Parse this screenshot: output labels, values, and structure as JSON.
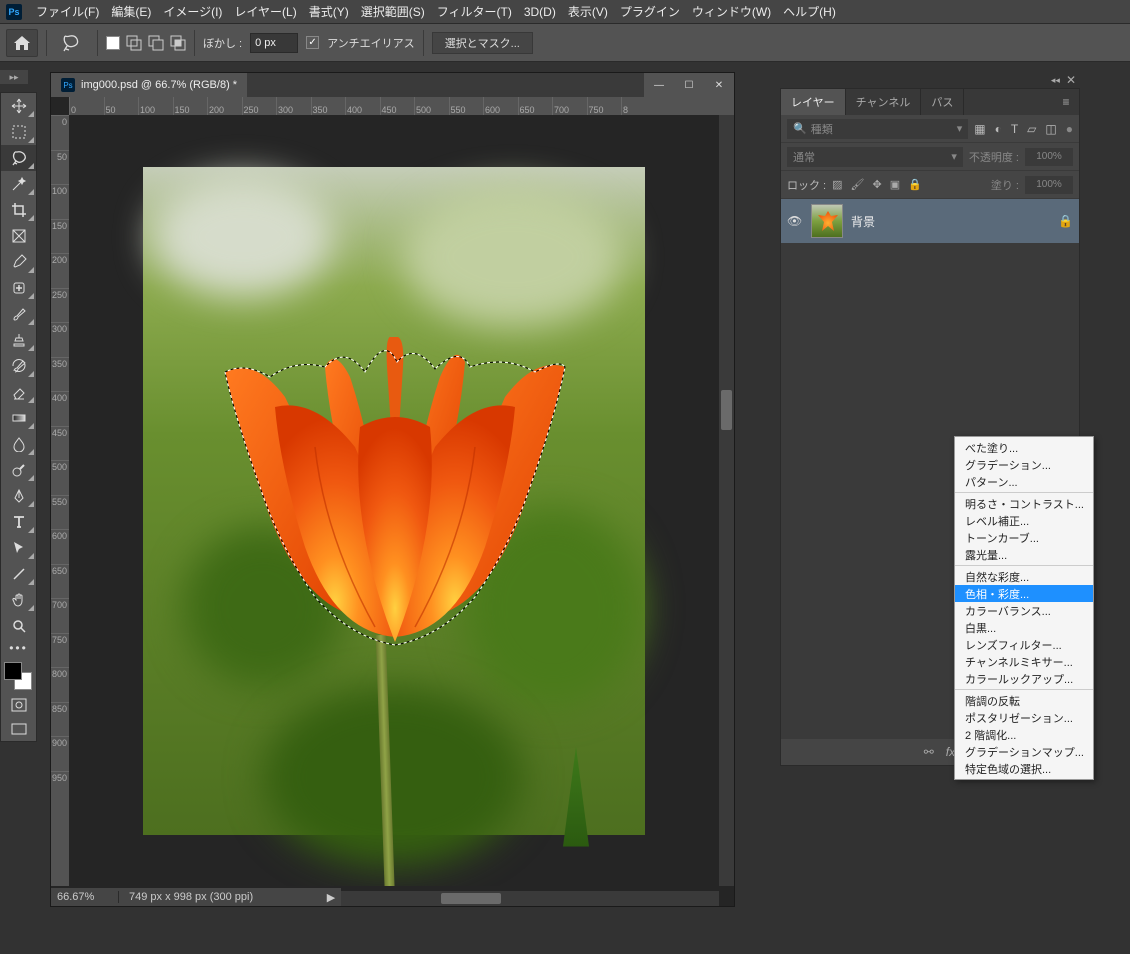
{
  "app_logo": "Ps",
  "menubar": [
    "ファイル(F)",
    "編集(E)",
    "イメージ(I)",
    "レイヤー(L)",
    "書式(Y)",
    "選択範囲(S)",
    "フィルター(T)",
    "3D(D)",
    "表示(V)",
    "プラグイン",
    "ウィンドウ(W)",
    "ヘルプ(H)"
  ],
  "options": {
    "blur_label": "ぼかし :",
    "blur_value": "0 px",
    "antialias": "アンチエイリアス",
    "antialias_checked": true,
    "select_mask": "選択とマスク..."
  },
  "document": {
    "tab_title": "img000.psd @ 66.7% (RGB/8) *",
    "zoom": "66.67%",
    "info": "749 px x 998 px (300 ppi)",
    "ruler_h": [
      "0",
      "50",
      "100",
      "150",
      "200",
      "250",
      "300",
      "350",
      "400",
      "450",
      "500",
      "550",
      "600",
      "650",
      "700",
      "750",
      "8"
    ],
    "ruler_v": [
      "0",
      "50",
      "100",
      "150",
      "200",
      "250",
      "300",
      "350",
      "400",
      "450",
      "500",
      "550",
      "600",
      "650",
      "700",
      "750",
      "800",
      "850",
      "900",
      "950"
    ]
  },
  "right_panel": {
    "tabs": [
      "レイヤー",
      "チャンネル",
      "パス"
    ],
    "kind_search": "種類",
    "blend_mode": "通常",
    "opacity_label": "不透明度 :",
    "opacity_value": "100%",
    "lock_label": "ロック :",
    "fill_label": "塗り :",
    "fill_value": "100%",
    "layer": {
      "name": "背景"
    }
  },
  "context_menu": {
    "groups": [
      [
        "べた塗り...",
        "グラデーション...",
        "パターン..."
      ],
      [
        "明るさ・コントラスト...",
        "レベル補正...",
        "トーンカーブ...",
        "露光量..."
      ],
      [
        "自然な彩度...",
        "色相・彩度...",
        "カラーバランス...",
        "白黒...",
        "レンズフィルター...",
        "チャンネルミキサー...",
        "カラールックアップ..."
      ],
      [
        "階調の反転",
        "ポスタリゼーション...",
        "2 階調化...",
        "グラデーションマップ...",
        "特定色域の選択..."
      ]
    ],
    "highlighted": "色相・彩度..."
  },
  "tools": [
    {
      "name": "move-tool",
      "corner": true
    },
    {
      "name": "marquee-tool",
      "corner": true
    },
    {
      "name": "lasso-tool",
      "corner": true,
      "selected": true
    },
    {
      "name": "magic-wand-tool",
      "corner": true
    },
    {
      "name": "crop-tool",
      "corner": true
    },
    {
      "name": "frame-tool",
      "corner": false
    },
    {
      "name": "eyedropper-tool",
      "corner": true
    },
    {
      "name": "heal-tool",
      "corner": true
    },
    {
      "name": "brush-tool",
      "corner": true
    },
    {
      "name": "stamp-tool",
      "corner": true
    },
    {
      "name": "history-brush-tool",
      "corner": true
    },
    {
      "name": "eraser-tool",
      "corner": true
    },
    {
      "name": "gradient-tool",
      "corner": true
    },
    {
      "name": "blur-tool",
      "corner": true
    },
    {
      "name": "dodge-tool",
      "corner": true
    },
    {
      "name": "pen-tool",
      "corner": true
    },
    {
      "name": "type-tool",
      "corner": true
    },
    {
      "name": "path-select-tool",
      "corner": true
    },
    {
      "name": "line-tool",
      "corner": true
    },
    {
      "name": "hand-tool",
      "corner": true
    },
    {
      "name": "zoom-tool",
      "corner": false
    }
  ]
}
